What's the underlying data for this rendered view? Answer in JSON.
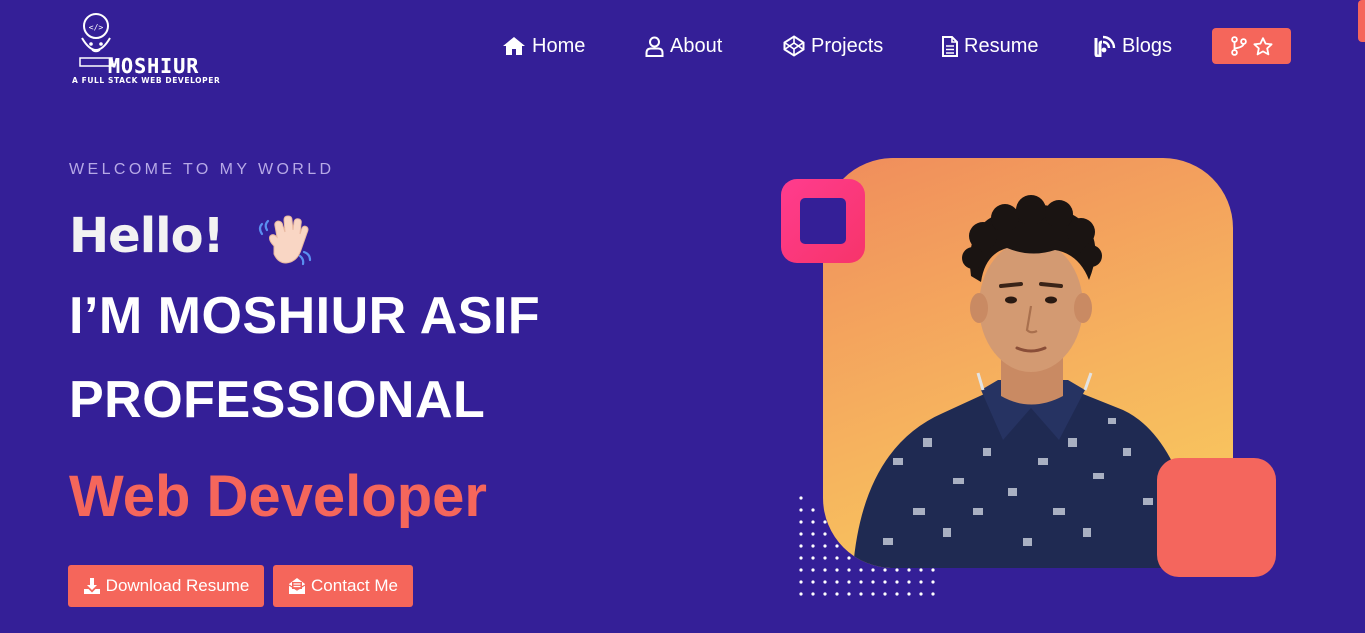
{
  "header": {
    "logo": {
      "wordmark": "MOSHIUR",
      "tagline": "A FULL STACK WEB DEVELOPER"
    },
    "nav": [
      {
        "label": "Home",
        "icon": "home-icon"
      },
      {
        "label": "About",
        "icon": "user-icon"
      },
      {
        "label": "Projects",
        "icon": "codepen-icon"
      },
      {
        "label": "Resume",
        "icon": "document-icon"
      },
      {
        "label": "Blogs",
        "icon": "blog-icon"
      }
    ],
    "github_button": {
      "icons": [
        "git-fork-icon",
        "star-icon"
      ]
    }
  },
  "hero": {
    "welcome": "WELCOME TO MY WORLD",
    "greeting": "Hello!",
    "greeting_emoji": "waving-hand-icon",
    "name_line": "I’M MOSHIUR ASIF",
    "title_line": "PROFESSIONAL",
    "role_line": "Web Developer",
    "buttons": {
      "download": "Download Resume",
      "contact": "Contact Me"
    }
  },
  "colors": {
    "background": "#341f97",
    "accent": "#f5665b",
    "pink": "#ff3c8e",
    "welcome_text": "#b6a9e6",
    "card_gradient_start": "#f08d5c",
    "card_gradient_end": "#f9cf5f"
  }
}
